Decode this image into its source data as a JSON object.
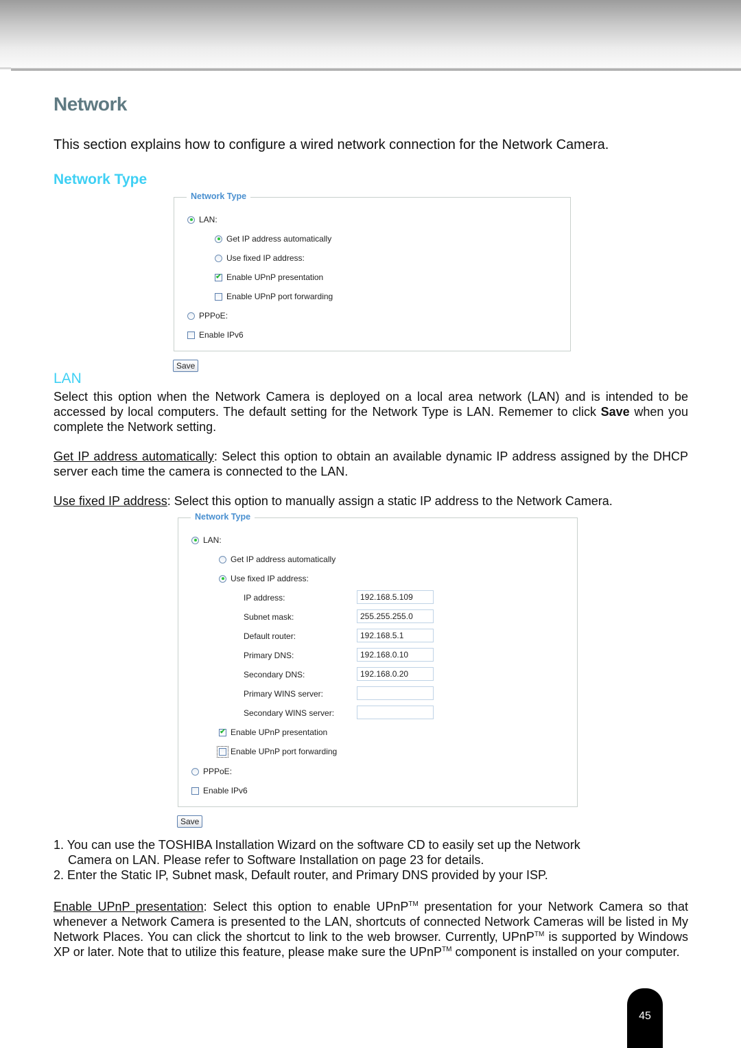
{
  "page": {
    "title": "Network",
    "intro": "This section explains how to configure a wired network connection for the Network Camera.",
    "section_network_type": "Network Type",
    "section_lan": "LAN",
    "page_number": "45"
  },
  "panel1": {
    "legend": "Network Type",
    "lan_label": "LAN:",
    "lan_selected": true,
    "get_ip_auto_label": "Get IP address automatically",
    "get_ip_auto_selected": true,
    "use_fixed_ip_label": "Use fixed IP address:",
    "use_fixed_ip_selected": false,
    "upnp_presentation_label": "Enable UPnP presentation",
    "upnp_presentation_checked": true,
    "upnp_port_forwarding_label": "Enable UPnP port forwarding",
    "upnp_port_forwarding_checked": false,
    "pppoe_label": "PPPoE:",
    "pppoe_selected": false,
    "ipv6_label": "Enable IPv6",
    "ipv6_checked": false,
    "save_label": "Save"
  },
  "panel2": {
    "legend": "Network Type",
    "lan_label": "LAN:",
    "lan_selected": true,
    "get_ip_auto_label": "Get IP address automatically",
    "get_ip_auto_selected": false,
    "use_fixed_ip_label": "Use fixed IP address:",
    "use_fixed_ip_selected": true,
    "fields": [
      {
        "label": "IP address:",
        "value": "192.168.5.109"
      },
      {
        "label": "Subnet mask:",
        "value": "255.255.255.0"
      },
      {
        "label": "Default router:",
        "value": "192.168.5.1"
      },
      {
        "label": "Primary DNS:",
        "value": "192.168.0.10"
      },
      {
        "label": "Secondary DNS:",
        "value": "192.168.0.20"
      },
      {
        "label": "Primary WINS server:",
        "value": ""
      },
      {
        "label": "Secondary WINS server:",
        "value": ""
      }
    ],
    "upnp_presentation_label": "Enable UPnP presentation",
    "upnp_presentation_checked": true,
    "upnp_port_forwarding_label": "Enable UPnP port forwarding",
    "upnp_port_forwarding_checked": false,
    "pppoe_label": "PPPoE:",
    "pppoe_selected": false,
    "ipv6_label": "Enable IPv6",
    "ipv6_checked": false,
    "save_label": "Save"
  },
  "text": {
    "lan_para_1": "Select this option when the Network Camera is deployed on a local area network (LAN) and is intended to be accessed by local computers. The default setting for the Network Type is LAN. Rememer to click ",
    "lan_para_1_bold": "Save",
    "lan_para_1_end": " when you complete the Network setting.",
    "get_ip_term": "Get IP address automatically",
    "get_ip_desc": ": Select this option to obtain an available dynamic IP address assigned by the DHCP server each time the camera is connected to the LAN.",
    "fixed_ip_term": "Use fixed IP address",
    "fixed_ip_desc": ": Select this option to manually assign a static IP address to the Network Camera.",
    "note_1a": "1. You can use the TOSHIBA Installation Wizard on the software CD to easily set up the Network",
    "note_1b": "Camera on LAN. Please refer to Software Installation on page 23 for details.",
    "note_2": "2. Enter the Static IP, Subnet mask, Default router, and Primary DNS provided by your ISP.",
    "upnp_term": "Enable UPnP presentation",
    "upnp_desc_1": ": Select this option to enable UPnP",
    "tm": "TM",
    "upnp_desc_2": " presentation for your Network Camera so that whenever a Network Camera is presented to the LAN, shortcuts of connected Network Cameras will be listed in My Network Places. You can click the shortcut to link to the web browser. Currently, UPnP",
    "upnp_desc_3": " is supported by Windows XP or later. Note that to utilize this feature, please make sure the UPnP",
    "upnp_desc_4": " component is installed on your computer."
  },
  "icons": {
    "check_glyph": "✔"
  }
}
